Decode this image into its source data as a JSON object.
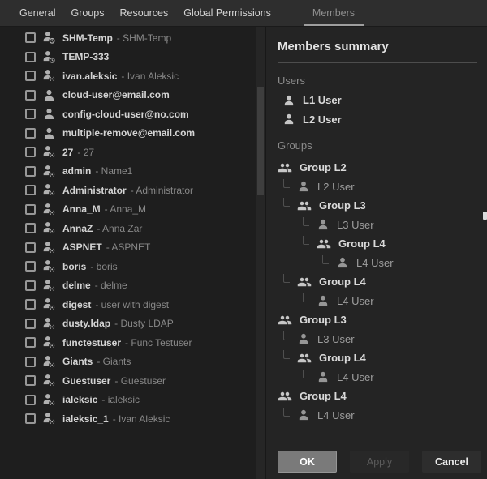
{
  "tabs": [
    {
      "label": "General",
      "active": false
    },
    {
      "label": "Groups",
      "active": false
    },
    {
      "label": "Resources",
      "active": false
    },
    {
      "label": "Global Permissions",
      "active": false
    },
    {
      "label": "Members",
      "active": true
    }
  ],
  "members_list": [
    {
      "name": "SHM-Temp",
      "description": "SHM-Temp",
      "icon": "user-clock-icon"
    },
    {
      "name": "TEMP-333",
      "description": "",
      "icon": "user-clock-icon"
    },
    {
      "name": "ivan.aleksic",
      "description": "Ivan Aleksic",
      "icon": "user-sync-icon"
    },
    {
      "name": "cloud-user@email.com",
      "description": "",
      "icon": "user-icon"
    },
    {
      "name": "config-cloud-user@no.com",
      "description": "",
      "icon": "user-icon"
    },
    {
      "name": "multiple-remove@email.com",
      "description": "",
      "icon": "user-icon"
    },
    {
      "name": "27",
      "description": "27",
      "icon": "user-sync-icon"
    },
    {
      "name": "admin",
      "description": "Name1",
      "icon": "user-sync-icon"
    },
    {
      "name": "Administrator",
      "description": "Administrator",
      "icon": "user-sync-icon"
    },
    {
      "name": "Anna_M",
      "description": "Anna_M",
      "icon": "user-sync-icon"
    },
    {
      "name": "AnnaZ",
      "description": "Anna Zar",
      "icon": "user-sync-icon"
    },
    {
      "name": "ASPNET",
      "description": "ASPNET",
      "icon": "user-sync-icon"
    },
    {
      "name": "boris",
      "description": "boris",
      "icon": "user-sync-icon"
    },
    {
      "name": "delme",
      "description": "delme",
      "icon": "user-sync-icon"
    },
    {
      "name": "digest",
      "description": "user with digest",
      "icon": "user-sync-icon"
    },
    {
      "name": "dusty.ldap",
      "description": "Dusty LDAP",
      "icon": "user-sync-icon"
    },
    {
      "name": "functestuser",
      "description": "Func Testuser",
      "icon": "user-sync-icon"
    },
    {
      "name": "Giants",
      "description": "Giants",
      "icon": "user-sync-icon"
    },
    {
      "name": "Guestuser",
      "description": "Guestuser",
      "icon": "user-sync-icon"
    },
    {
      "name": "ialeksic",
      "description": "ialeksic",
      "icon": "user-sync-icon"
    },
    {
      "name": "ialeksic_1",
      "description": "Ivan Aleksic",
      "icon": "user-sync-icon"
    }
  ],
  "summary": {
    "title": "Members summary",
    "users_label": "Users",
    "groups_label": "Groups",
    "users": [
      {
        "label": "L1 User",
        "icon": "user-icon"
      },
      {
        "label": "L2 User",
        "icon": "user-icon"
      }
    ],
    "groups_tree": [
      {
        "label": "Group L2",
        "type": "group",
        "level": 0,
        "icon": "group-icon"
      },
      {
        "label": "L2 User",
        "type": "user",
        "level": 1,
        "icon": "user-icon"
      },
      {
        "label": "Group L3",
        "type": "group",
        "level": 1,
        "icon": "group-icon"
      },
      {
        "label": "L3 User",
        "type": "user",
        "level": 2,
        "icon": "user-icon"
      },
      {
        "label": "Group L4",
        "type": "group",
        "level": 2,
        "icon": "group-icon"
      },
      {
        "label": "L4 User",
        "type": "user",
        "level": 3,
        "icon": "user-icon"
      },
      {
        "label": "Group L4",
        "type": "group",
        "level": 1,
        "icon": "group-icon"
      },
      {
        "label": "L4 User",
        "type": "user",
        "level": 2,
        "icon": "user-icon"
      },
      {
        "label": "Group L3",
        "type": "group",
        "level": 0,
        "icon": "group-icon"
      },
      {
        "label": "L3 User",
        "type": "user",
        "level": 1,
        "icon": "user-icon"
      },
      {
        "label": "Group L4",
        "type": "group",
        "level": 1,
        "icon": "group-icon"
      },
      {
        "label": "L4 User",
        "type": "user",
        "level": 2,
        "icon": "user-icon"
      },
      {
        "label": "Group L4",
        "type": "group",
        "level": 0,
        "icon": "group-icon"
      },
      {
        "label": "L4 User",
        "type": "user",
        "level": 1,
        "icon": "user-icon"
      }
    ]
  },
  "buttons": [
    {
      "label": "OK",
      "name": "ok-button",
      "disabled": false
    },
    {
      "label": "Apply",
      "name": "apply-button",
      "disabled": true
    },
    {
      "label": "Cancel",
      "name": "cancel-button",
      "disabled": false
    }
  ],
  "colors": {
    "tabbar_bg": "#2e2e2e",
    "left_panel_bg": "#1e1e1e",
    "right_panel_bg": "#242424",
    "active_tab_underline": "#9e9e9e",
    "ok_button_bg": "#7a7a7a",
    "primary_text": "#d4d4d4",
    "secondary_text": "#888888"
  }
}
